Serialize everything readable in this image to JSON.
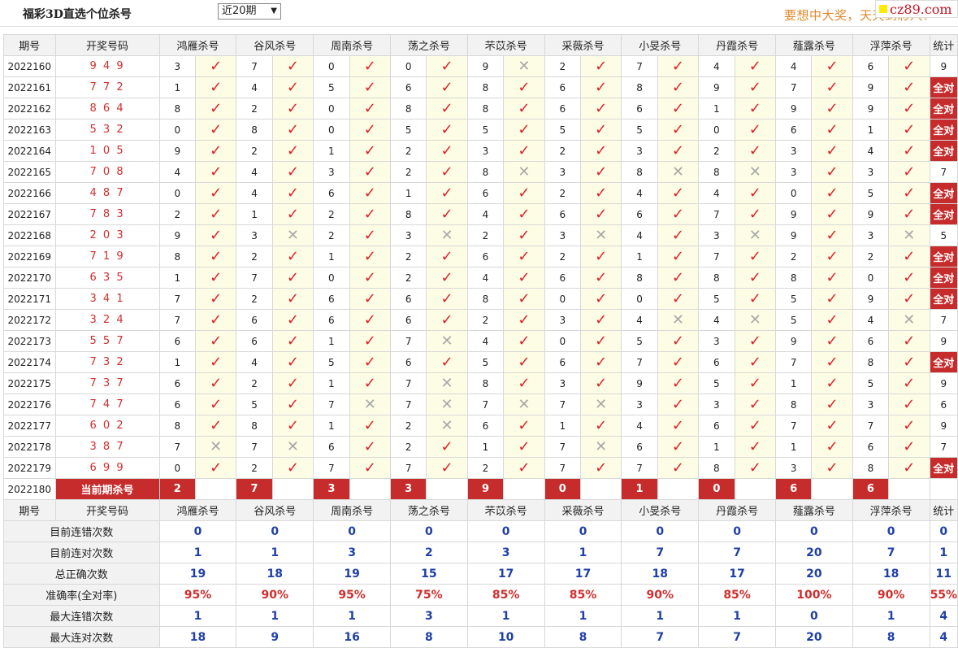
{
  "header": {
    "title": "福彩3D直选个位杀号",
    "period_select": "近20期",
    "slogan": "要想中大奖，天天到彩八！",
    "logo_text": "cz89.com"
  },
  "columns": {
    "period": "期号",
    "draw": "开奖号码",
    "experts": [
      "鸿雁杀号",
      "谷风杀号",
      "周南杀号",
      "荡之杀号",
      "芣苡杀号",
      "采薇杀号",
      "小旻杀号",
      "丹霞杀号",
      "薤露杀号",
      "浮萍杀号"
    ],
    "stats": "统计"
  },
  "marks": {
    "ok": "✓",
    "bad": "✕"
  },
  "rows": [
    {
      "period": "2022160",
      "draw": "9 4 9",
      "kills": [
        "3",
        "7",
        "0",
        "0",
        "9",
        "2",
        "7",
        "4",
        "4",
        "6"
      ],
      "result": [
        1,
        1,
        1,
        1,
        0,
        1,
        1,
        1,
        1,
        1
      ],
      "stat": "9"
    },
    {
      "period": "2022161",
      "draw": "7 7 2",
      "kills": [
        "1",
        "4",
        "5",
        "6",
        "8",
        "6",
        "8",
        "9",
        "7",
        "9"
      ],
      "result": [
        1,
        1,
        1,
        1,
        1,
        1,
        1,
        1,
        1,
        1
      ],
      "stat": "全对"
    },
    {
      "period": "2022162",
      "draw": "8 6 4",
      "kills": [
        "8",
        "2",
        "0",
        "8",
        "8",
        "6",
        "6",
        "1",
        "9",
        "9"
      ],
      "result": [
        1,
        1,
        1,
        1,
        1,
        1,
        1,
        1,
        1,
        1
      ],
      "stat": "全对"
    },
    {
      "period": "2022163",
      "draw": "5 3 2",
      "kills": [
        "0",
        "8",
        "0",
        "5",
        "5",
        "5",
        "5",
        "0",
        "6",
        "1"
      ],
      "result": [
        1,
        1,
        1,
        1,
        1,
        1,
        1,
        1,
        1,
        1
      ],
      "stat": "全对"
    },
    {
      "period": "2022164",
      "draw": "1 0 5",
      "kills": [
        "9",
        "2",
        "1",
        "2",
        "3",
        "2",
        "3",
        "2",
        "3",
        "4"
      ],
      "result": [
        1,
        1,
        1,
        1,
        1,
        1,
        1,
        1,
        1,
        1
      ],
      "stat": "全对"
    },
    {
      "period": "2022165",
      "draw": "7 0 8",
      "kills": [
        "4",
        "4",
        "3",
        "2",
        "8",
        "3",
        "8",
        "8",
        "3",
        "3"
      ],
      "result": [
        1,
        1,
        1,
        1,
        0,
        1,
        0,
        0,
        1,
        1
      ],
      "stat": "7"
    },
    {
      "period": "2022166",
      "draw": "4 8 7",
      "kills": [
        "0",
        "4",
        "6",
        "1",
        "6",
        "2",
        "4",
        "4",
        "0",
        "5"
      ],
      "result": [
        1,
        1,
        1,
        1,
        1,
        1,
        1,
        1,
        1,
        1
      ],
      "stat": "全对"
    },
    {
      "period": "2022167",
      "draw": "7 8 3",
      "kills": [
        "2",
        "1",
        "2",
        "8",
        "4",
        "6",
        "6",
        "7",
        "9",
        "9"
      ],
      "result": [
        1,
        1,
        1,
        1,
        1,
        1,
        1,
        1,
        1,
        1
      ],
      "stat": "全对"
    },
    {
      "period": "2022168",
      "draw": "2 0 3",
      "kills": [
        "9",
        "3",
        "2",
        "3",
        "2",
        "3",
        "4",
        "3",
        "9",
        "3"
      ],
      "result": [
        1,
        0,
        1,
        0,
        1,
        0,
        1,
        0,
        1,
        0
      ],
      "stat": "5"
    },
    {
      "period": "2022169",
      "draw": "7 1 9",
      "kills": [
        "8",
        "2",
        "1",
        "2",
        "6",
        "2",
        "1",
        "7",
        "2",
        "2"
      ],
      "result": [
        1,
        1,
        1,
        1,
        1,
        1,
        1,
        1,
        1,
        1
      ],
      "stat": "全对"
    },
    {
      "period": "2022170",
      "draw": "6 3 5",
      "kills": [
        "1",
        "7",
        "0",
        "2",
        "4",
        "6",
        "8",
        "8",
        "8",
        "0"
      ],
      "result": [
        1,
        1,
        1,
        1,
        1,
        1,
        1,
        1,
        1,
        1
      ],
      "stat": "全对"
    },
    {
      "period": "2022171",
      "draw": "3 4 1",
      "kills": [
        "7",
        "2",
        "6",
        "6",
        "8",
        "0",
        "0",
        "5",
        "5",
        "9"
      ],
      "result": [
        1,
        1,
        1,
        1,
        1,
        1,
        1,
        1,
        1,
        1
      ],
      "stat": "全对"
    },
    {
      "period": "2022172",
      "draw": "3 2 4",
      "kills": [
        "7",
        "6",
        "6",
        "6",
        "2",
        "3",
        "4",
        "4",
        "5",
        "4"
      ],
      "result": [
        1,
        1,
        1,
        1,
        1,
        1,
        0,
        0,
        1,
        0
      ],
      "stat": "7"
    },
    {
      "period": "2022173",
      "draw": "5 5 7",
      "kills": [
        "6",
        "6",
        "1",
        "7",
        "4",
        "0",
        "5",
        "3",
        "9",
        "6"
      ],
      "result": [
        1,
        1,
        1,
        0,
        1,
        1,
        1,
        1,
        1,
        1
      ],
      "stat": "9"
    },
    {
      "period": "2022174",
      "draw": "7 3 2",
      "kills": [
        "1",
        "4",
        "5",
        "6",
        "5",
        "6",
        "7",
        "6",
        "7",
        "8"
      ],
      "result": [
        1,
        1,
        1,
        1,
        1,
        1,
        1,
        1,
        1,
        1
      ],
      "stat": "全对"
    },
    {
      "period": "2022175",
      "draw": "7 3 7",
      "kills": [
        "6",
        "2",
        "1",
        "7",
        "8",
        "3",
        "9",
        "5",
        "1",
        "5"
      ],
      "result": [
        1,
        1,
        1,
        0,
        1,
        1,
        1,
        1,
        1,
        1
      ],
      "stat": "9"
    },
    {
      "period": "2022176",
      "draw": "7 4 7",
      "kills": [
        "6",
        "5",
        "7",
        "7",
        "7",
        "7",
        "3",
        "3",
        "8",
        "3"
      ],
      "result": [
        1,
        1,
        0,
        0,
        0,
        0,
        1,
        1,
        1,
        1
      ],
      "stat": "6"
    },
    {
      "period": "2022177",
      "draw": "6 0 2",
      "kills": [
        "8",
        "8",
        "1",
        "2",
        "6",
        "1",
        "4",
        "6",
        "7",
        "7"
      ],
      "result": [
        1,
        1,
        1,
        0,
        1,
        1,
        1,
        1,
        1,
        1
      ],
      "stat": "9"
    },
    {
      "period": "2022178",
      "draw": "3 8 7",
      "kills": [
        "7",
        "7",
        "6",
        "2",
        "1",
        "7",
        "6",
        "1",
        "1",
        "6"
      ],
      "result": [
        0,
        0,
        1,
        1,
        1,
        0,
        1,
        1,
        1,
        1
      ],
      "stat": "7"
    },
    {
      "period": "2022179",
      "draw": "6 9 9",
      "kills": [
        "0",
        "2",
        "7",
        "7",
        "2",
        "7",
        "7",
        "8",
        "3",
        "8"
      ],
      "result": [
        1,
        1,
        1,
        1,
        1,
        1,
        1,
        1,
        1,
        1
      ],
      "stat": "全对"
    }
  ],
  "current": {
    "period": "2022180",
    "label": "当前期杀号",
    "kills": [
      "2",
      "7",
      "3",
      "3",
      "9",
      "0",
      "1",
      "0",
      "6",
      "6"
    ]
  },
  "summary_rows": [
    {
      "label": "目前连错次数",
      "values": [
        "0",
        "0",
        "0",
        "0",
        "0",
        "0",
        "0",
        "0",
        "0",
        "0",
        "0"
      ]
    },
    {
      "label": "目前连对次数",
      "values": [
        "1",
        "1",
        "3",
        "2",
        "3",
        "1",
        "7",
        "7",
        "20",
        "7",
        "1"
      ]
    },
    {
      "label": "总正确次数",
      "values": [
        "19",
        "18",
        "19",
        "15",
        "17",
        "17",
        "18",
        "17",
        "20",
        "18",
        "11"
      ]
    },
    {
      "label": "准确率(全对率)",
      "values": [
        "95%",
        "90%",
        "95%",
        "75%",
        "85%",
        "85%",
        "90%",
        "85%",
        "100%",
        "90%",
        "55%"
      ],
      "rate": true
    },
    {
      "label": "最大连错次数",
      "values": [
        "1",
        "1",
        "1",
        "3",
        "1",
        "1",
        "1",
        "1",
        "0",
        "1",
        "4"
      ]
    },
    {
      "label": "最大连对次数",
      "values": [
        "18",
        "9",
        "16",
        "8",
        "10",
        "8",
        "7",
        "7",
        "20",
        "8",
        "4"
      ]
    }
  ]
}
